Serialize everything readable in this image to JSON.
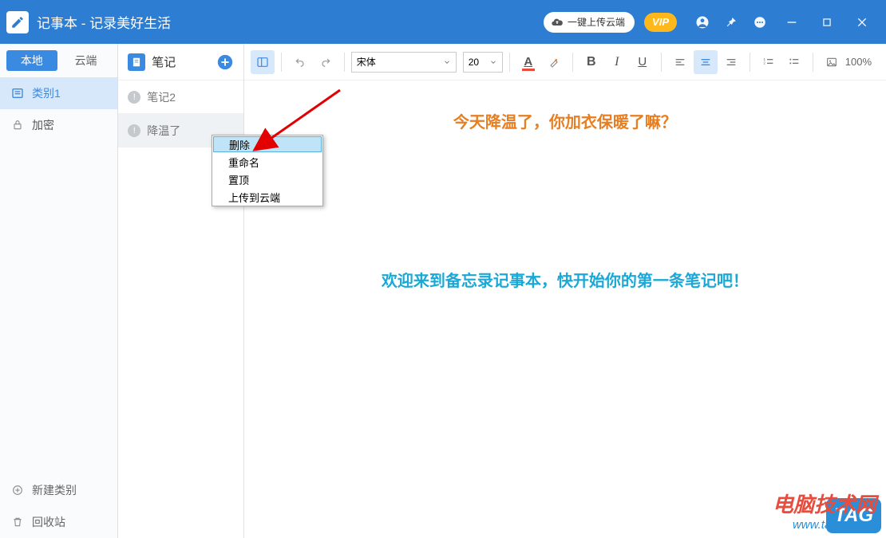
{
  "titlebar": {
    "title": "记事本 - 记录美好生活",
    "upload_btn": "一键上传云端",
    "vip": "VIP"
  },
  "sidebar": {
    "tabs": {
      "local": "本地",
      "cloud": "云端"
    },
    "categories": [
      {
        "label": "类别1"
      },
      {
        "label": "加密"
      }
    ],
    "add_category": "新建类别",
    "recycle_bin": "回收站"
  },
  "notelist": {
    "header_label": "笔记",
    "items": [
      {
        "label": "笔记2"
      },
      {
        "label": "降温了"
      }
    ]
  },
  "toolbar": {
    "font_family": "宋体",
    "font_size": "20",
    "zoom": "100%"
  },
  "context_menu": {
    "items": [
      "删除",
      "重命名",
      "置顶",
      "上传到云端"
    ]
  },
  "document": {
    "line1": "今天降温了，你加衣保暖了嘛？",
    "line2": "欢迎来到备忘录记事本，快开始你的第一条笔记吧！"
  },
  "watermark": {
    "line1": "电脑技术网",
    "line2": "www.tagxp.com",
    "tag": "TAG"
  }
}
